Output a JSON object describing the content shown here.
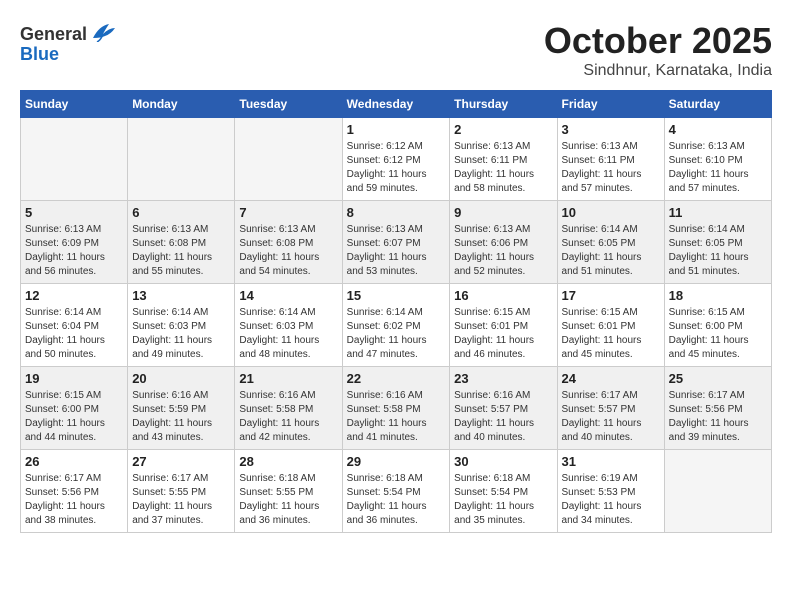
{
  "header": {
    "logo_general": "General",
    "logo_blue": "Blue",
    "month": "October 2025",
    "location": "Sindhnur, Karnataka, India"
  },
  "weekdays": [
    "Sunday",
    "Monday",
    "Tuesday",
    "Wednesday",
    "Thursday",
    "Friday",
    "Saturday"
  ],
  "weeks": [
    [
      {
        "day": "",
        "sunrise": "",
        "sunset": "",
        "daylight": ""
      },
      {
        "day": "",
        "sunrise": "",
        "sunset": "",
        "daylight": ""
      },
      {
        "day": "",
        "sunrise": "",
        "sunset": "",
        "daylight": ""
      },
      {
        "day": "1",
        "sunrise": "Sunrise: 6:12 AM",
        "sunset": "Sunset: 6:12 PM",
        "daylight": "Daylight: 11 hours and 59 minutes."
      },
      {
        "day": "2",
        "sunrise": "Sunrise: 6:13 AM",
        "sunset": "Sunset: 6:11 PM",
        "daylight": "Daylight: 11 hours and 58 minutes."
      },
      {
        "day": "3",
        "sunrise": "Sunrise: 6:13 AM",
        "sunset": "Sunset: 6:11 PM",
        "daylight": "Daylight: 11 hours and 57 minutes."
      },
      {
        "day": "4",
        "sunrise": "Sunrise: 6:13 AM",
        "sunset": "Sunset: 6:10 PM",
        "daylight": "Daylight: 11 hours and 57 minutes."
      }
    ],
    [
      {
        "day": "5",
        "sunrise": "Sunrise: 6:13 AM",
        "sunset": "Sunset: 6:09 PM",
        "daylight": "Daylight: 11 hours and 56 minutes."
      },
      {
        "day": "6",
        "sunrise": "Sunrise: 6:13 AM",
        "sunset": "Sunset: 6:08 PM",
        "daylight": "Daylight: 11 hours and 55 minutes."
      },
      {
        "day": "7",
        "sunrise": "Sunrise: 6:13 AM",
        "sunset": "Sunset: 6:08 PM",
        "daylight": "Daylight: 11 hours and 54 minutes."
      },
      {
        "day": "8",
        "sunrise": "Sunrise: 6:13 AM",
        "sunset": "Sunset: 6:07 PM",
        "daylight": "Daylight: 11 hours and 53 minutes."
      },
      {
        "day": "9",
        "sunrise": "Sunrise: 6:13 AM",
        "sunset": "Sunset: 6:06 PM",
        "daylight": "Daylight: 11 hours and 52 minutes."
      },
      {
        "day": "10",
        "sunrise": "Sunrise: 6:14 AM",
        "sunset": "Sunset: 6:05 PM",
        "daylight": "Daylight: 11 hours and 51 minutes."
      },
      {
        "day": "11",
        "sunrise": "Sunrise: 6:14 AM",
        "sunset": "Sunset: 6:05 PM",
        "daylight": "Daylight: 11 hours and 51 minutes."
      }
    ],
    [
      {
        "day": "12",
        "sunrise": "Sunrise: 6:14 AM",
        "sunset": "Sunset: 6:04 PM",
        "daylight": "Daylight: 11 hours and 50 minutes."
      },
      {
        "day": "13",
        "sunrise": "Sunrise: 6:14 AM",
        "sunset": "Sunset: 6:03 PM",
        "daylight": "Daylight: 11 hours and 49 minutes."
      },
      {
        "day": "14",
        "sunrise": "Sunrise: 6:14 AM",
        "sunset": "Sunset: 6:03 PM",
        "daylight": "Daylight: 11 hours and 48 minutes."
      },
      {
        "day": "15",
        "sunrise": "Sunrise: 6:14 AM",
        "sunset": "Sunset: 6:02 PM",
        "daylight": "Daylight: 11 hours and 47 minutes."
      },
      {
        "day": "16",
        "sunrise": "Sunrise: 6:15 AM",
        "sunset": "Sunset: 6:01 PM",
        "daylight": "Daylight: 11 hours and 46 minutes."
      },
      {
        "day": "17",
        "sunrise": "Sunrise: 6:15 AM",
        "sunset": "Sunset: 6:01 PM",
        "daylight": "Daylight: 11 hours and 45 minutes."
      },
      {
        "day": "18",
        "sunrise": "Sunrise: 6:15 AM",
        "sunset": "Sunset: 6:00 PM",
        "daylight": "Daylight: 11 hours and 45 minutes."
      }
    ],
    [
      {
        "day": "19",
        "sunrise": "Sunrise: 6:15 AM",
        "sunset": "Sunset: 6:00 PM",
        "daylight": "Daylight: 11 hours and 44 minutes."
      },
      {
        "day": "20",
        "sunrise": "Sunrise: 6:16 AM",
        "sunset": "Sunset: 5:59 PM",
        "daylight": "Daylight: 11 hours and 43 minutes."
      },
      {
        "day": "21",
        "sunrise": "Sunrise: 6:16 AM",
        "sunset": "Sunset: 5:58 PM",
        "daylight": "Daylight: 11 hours and 42 minutes."
      },
      {
        "day": "22",
        "sunrise": "Sunrise: 6:16 AM",
        "sunset": "Sunset: 5:58 PM",
        "daylight": "Daylight: 11 hours and 41 minutes."
      },
      {
        "day": "23",
        "sunrise": "Sunrise: 6:16 AM",
        "sunset": "Sunset: 5:57 PM",
        "daylight": "Daylight: 11 hours and 40 minutes."
      },
      {
        "day": "24",
        "sunrise": "Sunrise: 6:17 AM",
        "sunset": "Sunset: 5:57 PM",
        "daylight": "Daylight: 11 hours and 40 minutes."
      },
      {
        "day": "25",
        "sunrise": "Sunrise: 6:17 AM",
        "sunset": "Sunset: 5:56 PM",
        "daylight": "Daylight: 11 hours and 39 minutes."
      }
    ],
    [
      {
        "day": "26",
        "sunrise": "Sunrise: 6:17 AM",
        "sunset": "Sunset: 5:56 PM",
        "daylight": "Daylight: 11 hours and 38 minutes."
      },
      {
        "day": "27",
        "sunrise": "Sunrise: 6:17 AM",
        "sunset": "Sunset: 5:55 PM",
        "daylight": "Daylight: 11 hours and 37 minutes."
      },
      {
        "day": "28",
        "sunrise": "Sunrise: 6:18 AM",
        "sunset": "Sunset: 5:55 PM",
        "daylight": "Daylight: 11 hours and 36 minutes."
      },
      {
        "day": "29",
        "sunrise": "Sunrise: 6:18 AM",
        "sunset": "Sunset: 5:54 PM",
        "daylight": "Daylight: 11 hours and 36 minutes."
      },
      {
        "day": "30",
        "sunrise": "Sunrise: 6:18 AM",
        "sunset": "Sunset: 5:54 PM",
        "daylight": "Daylight: 11 hours and 35 minutes."
      },
      {
        "day": "31",
        "sunrise": "Sunrise: 6:19 AM",
        "sunset": "Sunset: 5:53 PM",
        "daylight": "Daylight: 11 hours and 34 minutes."
      },
      {
        "day": "",
        "sunrise": "",
        "sunset": "",
        "daylight": ""
      }
    ]
  ]
}
